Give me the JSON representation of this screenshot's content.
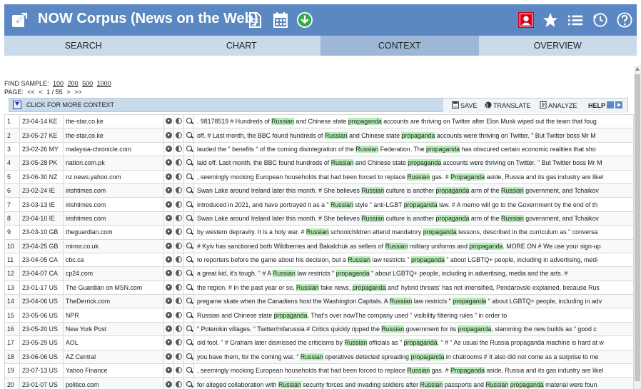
{
  "header": {
    "title": "NOW Corpus (News on the Web)",
    "color": "#5b88c2",
    "icons": [
      "external-link-icon",
      "document-icon",
      "calendar-icon",
      "download-icon",
      "user-icon",
      "star-icon",
      "list-icon",
      "history-icon",
      "help-icon"
    ]
  },
  "tabs": [
    {
      "label": "SEARCH",
      "active": false
    },
    {
      "label": "CHART",
      "active": false
    },
    {
      "label": "CONTEXT",
      "active": true
    },
    {
      "label": "OVERVIEW",
      "active": false
    }
  ],
  "sample": {
    "label": "FIND SAMPLE:",
    "options": [
      "100",
      "200",
      "500",
      "1000"
    ]
  },
  "paging": {
    "label": "PAGE:",
    "first": "<<",
    "prev": "<",
    "current": "1 / 55",
    "next": ">",
    "last": ">>"
  },
  "context_bar": {
    "more_label": "CLICK FOR MORE CONTEXT",
    "save": "SAVE",
    "translate": "TRANSLATE",
    "analyze": "ANALYZE",
    "help": "HELP"
  },
  "rows": [
    {
      "num": "1",
      "date": "23-04-14 KE",
      "source": "the-star.co.ke",
      "context": [
        ". 98178519 # Hundreds of ",
        {
          "hl": "Russian"
        },
        " and Chinese state ",
        {
          "hl": "propaganda"
        },
        " accounts are thriving on Twitter after Elon Musk wiped out the team that foug"
      ]
    },
    {
      "num": "2",
      "date": "23-05-27 KE",
      "source": "the-star.co.ke",
      "context": [
        "off. # Last month, the BBC found hundreds of ",
        {
          "hl": "Russian"
        },
        " and Chinese state ",
        {
          "hl": "propaganda"
        },
        " accounts were thriving on Twitter. \" But Twitter boss Mr M"
      ]
    },
    {
      "num": "3",
      "date": "23-02-26 MY",
      "source": "malaysia-chronicle.com",
      "context": [
        "lauded the \" benefits \" of the coming disintegration of the ",
        {
          "hl": "Russian"
        },
        " Federation. The ",
        {
          "hl": "propaganda"
        },
        " has obscured certain economic realities that sho"
      ]
    },
    {
      "num": "4",
      "date": "23-05-28 PK",
      "source": "nation.com.pk",
      "context": [
        "laid off. Last month, the BBC found hundreds of ",
        {
          "hl": "Russian"
        },
        " and Chinese state ",
        {
          "hl": "propaganda"
        },
        " accounts were thriving on Twitter. \" But Twitter boss Mr M"
      ]
    },
    {
      "num": "5",
      "date": "23-06-30 NZ",
      "source": "nz.news.yahoo.com",
      "context": [
        ", seemingly mocking European households that had been forced to replace ",
        {
          "hl": "Russian"
        },
        " gas. # ",
        {
          "hl": "Propaganda"
        },
        " aside, Russia and its gas industry are likel"
      ]
    },
    {
      "num": "6",
      "date": "23-02-24 IE",
      "source": "irishtimes.com",
      "context": [
        "Swan Lake around Ireland later this month. # She believes ",
        {
          "hl": "Russian"
        },
        " culture is another ",
        {
          "hl": "propaganda"
        },
        " arm of the ",
        {
          "hl": "Russian"
        },
        " government, and Tchaikov"
      ]
    },
    {
      "num": "7",
      "date": "23-03-13 IE",
      "source": "irishtimes.com",
      "context": [
        "introduced in 2021, and have portrayed it as a \" ",
        {
          "hl": "Russian"
        },
        " style \" anti-LGBT ",
        {
          "hl": "propaganda"
        },
        " law. # A memo will go to the Government by the end of th"
      ]
    },
    {
      "num": "8",
      "date": "23-04-10 IE",
      "source": "irishtimes.com",
      "context": [
        "Swan Lake around Ireland later this month. # She believes ",
        {
          "hl": "Russian"
        },
        " culture is another ",
        {
          "hl": "propaganda"
        },
        " arm of the ",
        {
          "hl": "Russian"
        },
        " government, and Tchaikov"
      ]
    },
    {
      "num": "9",
      "date": "23-03-10 GB",
      "source": "theguardian.com",
      "context": [
        "by western depravity. It is a holy war. # ",
        {
          "hl": "Russian"
        },
        " schoolchildren attend mandatory ",
        {
          "hl": "propaganda"
        },
        " lessons, described in the curriculum as \" conversa"
      ]
    },
    {
      "num": "10",
      "date": "23-04-25 GB",
      "source": "mirror.co.uk",
      "context": [
        "# Kyiv has sanctioned both Wildberries and Bakalchuk as sellers of ",
        {
          "hl": "Russian"
        },
        " military uniforms and ",
        {
          "hl": "propaganda"
        },
        ". MORE ON # We use your sign-up"
      ]
    },
    {
      "num": "11",
      "date": "23-04-05 CA",
      "source": "cbc.ca",
      "context": [
        "to reporters before the game about his decision, but a ",
        {
          "hl": "Russian"
        },
        " law restricts \" ",
        {
          "hl": "propaganda"
        },
        " \" about LGBTQ+ people, including in advertising, medi"
      ]
    },
    {
      "num": "12",
      "date": "23-04-07 CA",
      "source": "cp24.com",
      "context": [
        "a great kid, it's tough. \" # A ",
        {
          "hl": "Russian"
        },
        " law restricts \" ",
        {
          "hl": "propaganda"
        },
        " \" about LGBTQ+ people, including in advertising, media and the arts. #"
      ]
    },
    {
      "num": "13",
      "date": "23-01-17 US",
      "source": "The Guardian on MSN.com",
      "context": [
        "the region. # In the past year or so, ",
        {
          "hl": "Russian"
        },
        " fake news, ",
        {
          "hl": "propaganda"
        },
        " and' hybrid threats' has not intensified, Pendarovski explained, because Rus"
      ]
    },
    {
      "num": "14",
      "date": "23-04-06 US",
      "source": "TheDerrick.com",
      "context": [
        "pregame skate when the Canadiens host the Washington Capitals. A ",
        {
          "hl": "Russian"
        },
        " law restricts \" ",
        {
          "hl": "propaganda"
        },
        " \" about LGBTQ+ people, including in adv"
      ]
    },
    {
      "num": "15",
      "date": "23-05-06 US",
      "source": "NPR",
      "context": [
        "Russian and Chinese state ",
        {
          "hl": "propaganda"
        },
        ". That's over nowThe company used \" visibility filtering rules \" in order to"
      ]
    },
    {
      "num": "16",
      "date": "23-05-20 US",
      "source": "New York Post",
      "context": [
        "\" Potemkin villages. \" Twitter/mfarussia # Critics quickly ripped the ",
        {
          "hl": "Russian"
        },
        " government for its ",
        {
          "hl": "propaganda"
        },
        ", slamming the new builds as \" good c"
      ]
    },
    {
      "num": "17",
      "date": "23-05-29 US",
      "source": "AOL",
      "context": [
        "old fool. \" # Graham later dismissed the criticisms by ",
        {
          "hl": "Russian"
        },
        " officials as \" ",
        {
          "hl": "propaganda"
        },
        ". \" # \" As usual the Russia propaganda machine is hard at w"
      ]
    },
    {
      "num": "18",
      "date": "23-06-06 US",
      "source": "AZ Central",
      "context": [
        "you have them, for the coming war. \" ",
        {
          "hl": "Russian"
        },
        " operatives detected spreading ",
        {
          "hl": "propaganda"
        },
        " in chatrooms # It also did not come as a surprise to me"
      ]
    },
    {
      "num": "19",
      "date": "23-07-13 US",
      "source": "Yahoo Finance",
      "context": [
        ", seemingly mocking European households that had been forced to replace ",
        {
          "hl": "Russian"
        },
        " gas. # ",
        {
          "hl": "Propaganda"
        },
        " aside, Russia and its gas industry are likel"
      ]
    },
    {
      "num": "20",
      "date": "23-01-07 US",
      "source": "politico.com",
      "context": [
        "for alleged collaboration with ",
        {
          "hl": "Russian"
        },
        " security forces and invading soldiers after ",
        {
          "hl": "Russian"
        },
        " passports and ",
        {
          "hl": "Russian"
        },
        " ",
        {
          "hl": "propaganda"
        },
        " material were foun"
      ]
    }
  ]
}
